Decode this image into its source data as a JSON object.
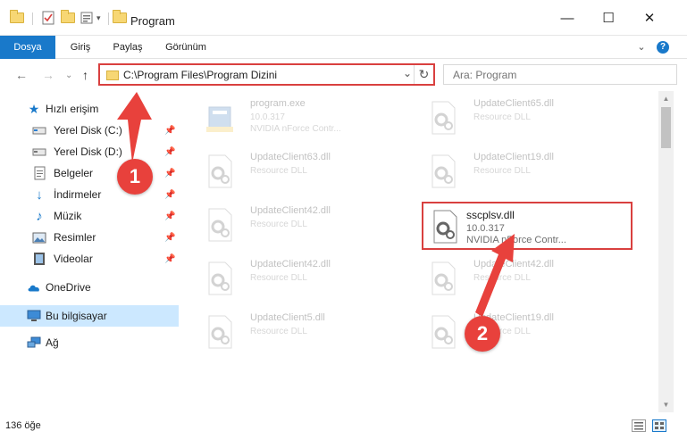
{
  "window": {
    "title": "Program",
    "minimize": "—",
    "maximize": "☐",
    "close": "✕"
  },
  "ribbon": {
    "tabs": [
      "Dosya",
      "Giriş",
      "Paylaş",
      "Görünüm"
    ],
    "expand": "⌄",
    "help": "?"
  },
  "address": {
    "path": "C:\\Program Files\\Program Dizini",
    "chevron": "⌄",
    "refresh": "↻"
  },
  "search": {
    "placeholder": "Ara: Program"
  },
  "nav": {
    "back": "←",
    "forward": "→",
    "recent": "⌄",
    "up": "↑"
  },
  "sidebar": {
    "quick_access": "Hızlı erişim",
    "items": [
      {
        "label": "Yerel Disk (C:)",
        "icon": "drive-icon",
        "pinned": true
      },
      {
        "label": "Yerel Disk (D:)",
        "icon": "drive-icon",
        "pinned": true
      },
      {
        "label": "Belgeler",
        "icon": "documents-icon",
        "pinned": true
      },
      {
        "label": "İndirmeler",
        "icon": "downloads-icon",
        "pinned": true
      },
      {
        "label": "Müzik",
        "icon": "music-icon",
        "pinned": true
      },
      {
        "label": "Resimler",
        "icon": "pictures-icon",
        "pinned": true
      },
      {
        "label": "Videolar",
        "icon": "videos-icon",
        "pinned": true
      }
    ],
    "onedrive": "OneDrive",
    "this_pc": "Bu bilgisayar",
    "network": "Ağ",
    "pin_glyph": "📌"
  },
  "files": [
    {
      "name": "program.exe",
      "l2": "10.0.317",
      "l3": "NVIDIA nForce Contr...",
      "icon": "exe-icon"
    },
    {
      "name": "UpdateClient65.dll",
      "l2": "Resource DLL",
      "l3": "",
      "icon": "dll-icon"
    },
    {
      "name": "UpdateClient63.dll",
      "l2": "Resource DLL",
      "l3": "",
      "icon": "dll-icon"
    },
    {
      "name": "UpdateClient19.dll",
      "l2": "Resource DLL",
      "l3": "",
      "icon": "dll-icon"
    },
    {
      "name": "UpdateClient42.dll",
      "l2": "Resource DLL",
      "l3": "",
      "icon": "dll-icon"
    },
    {
      "name": "sscplsv.dll",
      "l2": "10.0.317",
      "l3": "NVIDIA nForce Contr...",
      "icon": "dll-icon",
      "highlighted": true
    },
    {
      "name": "UpdateClient42.dll",
      "l2": "Resource DLL",
      "l3": "",
      "icon": "dll-icon"
    },
    {
      "name": "UpdateClient42.dll",
      "l2": "Resource DLL",
      "l3": "",
      "icon": "dll-icon"
    },
    {
      "name": "UpdateClient5.dll",
      "l2": "Resource DLL",
      "l3": "",
      "icon": "dll-icon"
    },
    {
      "name": "UpdateClient19.dll",
      "l2": "Resource DLL",
      "l3": "",
      "icon": "dll-icon"
    }
  ],
  "status": {
    "count": "136 öğe"
  },
  "annotations": {
    "step1": "1",
    "step2": "2",
    "color": "#e8413c"
  },
  "colors": {
    "accent": "#1979ca",
    "selection": "#cce8ff",
    "highlight_border": "#d9403f"
  }
}
